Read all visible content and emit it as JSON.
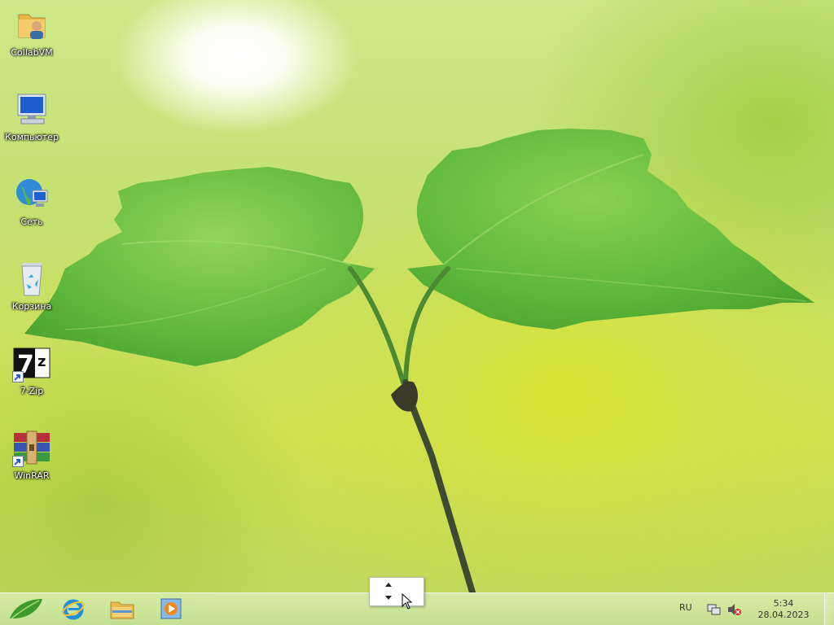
{
  "desktop": {
    "icons": [
      {
        "label": "CollabVM",
        "icon": "user-folder-icon"
      },
      {
        "label": "Компьютер",
        "icon": "computer-icon"
      },
      {
        "label": "Сеть",
        "icon": "network-icon"
      },
      {
        "label": "Корзина",
        "icon": "recycle-bin-icon"
      },
      {
        "label": "7-Zip",
        "icon": "7zip-icon",
        "shortcut_text": "7z"
      },
      {
        "label": "WinRAR",
        "icon": "winrar-icon"
      }
    ]
  },
  "taskbar": {
    "pinned": [
      {
        "icon": "start-leaf-icon"
      },
      {
        "icon": "internet-explorer-icon"
      },
      {
        "icon": "file-explorer-icon"
      },
      {
        "icon": "media-player-icon"
      }
    ],
    "tray": {
      "language": "RU",
      "time": "5:34",
      "date": "28.04.2023"
    }
  },
  "colors": {
    "taskbar": "#cde4a0",
    "leaf": "#5fb83a",
    "accent_ie": "#1f8fe0"
  }
}
